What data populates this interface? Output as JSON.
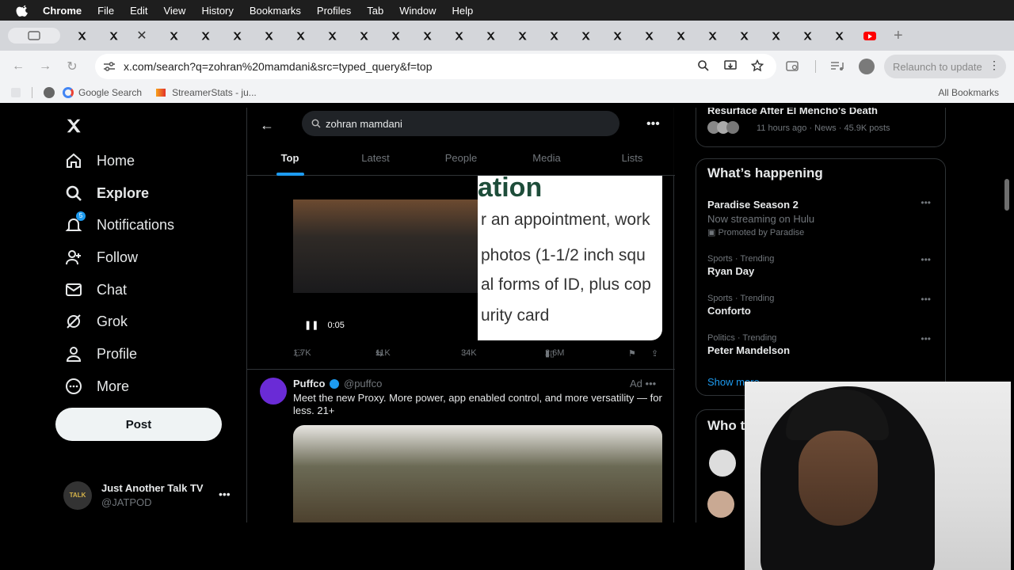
{
  "menubar": {
    "app": "Chrome",
    "items": [
      "File",
      "Edit",
      "View",
      "History",
      "Bookmarks",
      "Profiles",
      "Tab",
      "Window",
      "Help"
    ]
  },
  "browser": {
    "url": "x.com/search?q=zohran%20mamdani&src=typed_query&f=top",
    "relaunch_label": "Relaunch to update",
    "bookmarks": [
      "Google Search",
      "StreamerStats - ju..."
    ],
    "all_bookmarks": "All Bookmarks"
  },
  "leftnav": {
    "items": [
      {
        "label": "Home",
        "icon": "home-icon"
      },
      {
        "label": "Explore",
        "icon": "search-icon"
      },
      {
        "label": "Notifications",
        "icon": "bell-icon",
        "badge": "5"
      },
      {
        "label": "Follow",
        "icon": "follow-icon"
      },
      {
        "label": "Chat",
        "icon": "mail-icon"
      },
      {
        "label": "Grok",
        "icon": "grok-icon"
      },
      {
        "label": "Profile",
        "icon": "person-icon"
      },
      {
        "label": "More",
        "icon": "more-icon"
      }
    ],
    "post_label": "Post",
    "account": {
      "name": "Just Another Talk TV",
      "handle": "@JATPOD",
      "avatar_text": "TALK"
    }
  },
  "search": {
    "query": "zohran mamdani",
    "tabs": [
      "Top",
      "Latest",
      "People",
      "Media",
      "Lists"
    ],
    "active_tab": "Top"
  },
  "tweet": {
    "video_time": "0:05",
    "video_text": {
      "heading": "ation",
      "lines": [
        "r an appointment, work",
        "photos (1-1/2 inch squ",
        "al forms of ID, plus cop",
        "urity card"
      ]
    },
    "replies": "1.7K",
    "reposts": "11K",
    "likes": "34K",
    "views": "2.6M"
  },
  "ad": {
    "name": "Puffco",
    "handle": "@puffco",
    "ad_label": "Ad",
    "text": "Meet the new Proxy. More power, app enabled control, and more versatility — for less. 21+"
  },
  "right": {
    "top_trend": {
      "title": "Resurface After El Mencho's Death",
      "meta": "11 hours ago · News · 45.9K posts"
    },
    "happening_title": "What’s happening",
    "trends": [
      {
        "name": "Paradise Season 2",
        "sub": "Now streaming on Hulu",
        "promo": "Promoted by Paradise"
      },
      {
        "category": "Sports · Trending",
        "name": "Ryan Day"
      },
      {
        "category": "Sports · Trending",
        "name": "Conforto"
      },
      {
        "category": "Politics · Trending",
        "name": "Peter Mandelson"
      }
    ],
    "show_more": "Show more",
    "who_title": "Who t"
  },
  "colors": {
    "accent": "#1d9bf0",
    "bg": "#000000",
    "text": "#e7e9ea",
    "muted": "#71767b"
  }
}
